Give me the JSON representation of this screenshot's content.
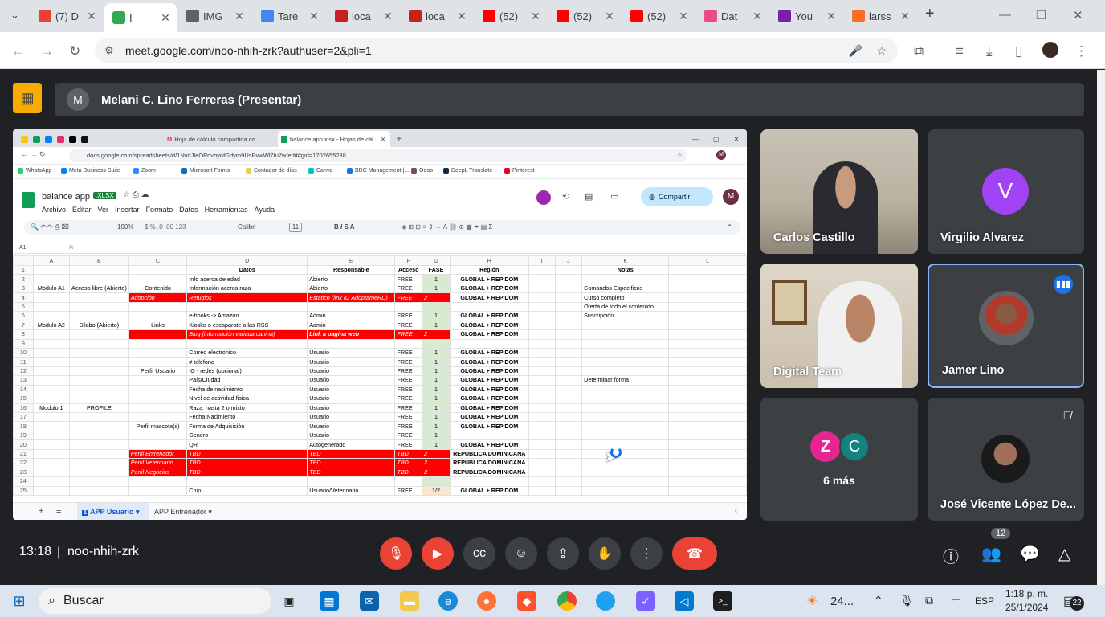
{
  "browser": {
    "tabs": [
      {
        "label": "(7) D",
        "color": "#e94235"
      },
      {
        "label": "I",
        "color": "#34a853",
        "active": true
      },
      {
        "label": "IMG",
        "color": "#5f6368"
      },
      {
        "label": "Tare",
        "color": "#4285f4"
      },
      {
        "label": "loca",
        "color": "#c5221f"
      },
      {
        "label": "loca",
        "color": "#c5221f"
      },
      {
        "label": "(52)",
        "color": "#ff0000"
      },
      {
        "label": "(52)",
        "color": "#ff0000"
      },
      {
        "label": "(52)",
        "color": "#ff0000"
      },
      {
        "label": "Dat",
        "color": "#ea4c89"
      },
      {
        "label": "You",
        "color": "#7b1fa2"
      },
      {
        "label": "larss",
        "color": "#fc6d26"
      }
    ],
    "url": "meet.google.com/noo-nhih-zrk?authuser=2&pli=1"
  },
  "meet": {
    "presenter_initial": "M",
    "presenter_title": "Melani C. Lino Ferreras (Presentar)",
    "time": "13:18",
    "meeting_code": "noo-nhih-zrk",
    "participant_count": "12",
    "participants": [
      {
        "name": "Carlos Castillo"
      },
      {
        "name": "Virgilio Alvarez",
        "initial": "V"
      },
      {
        "name": "Digital Team"
      },
      {
        "name": "Jamer Lino"
      },
      {
        "name": "6 más",
        "initials": [
          "Z",
          "C"
        ]
      },
      {
        "name": "José Vicente López De..."
      }
    ]
  },
  "shared": {
    "tabs": [
      "Hoja de cálculo compartida co",
      "balance app.xlsx - Hojas de cál"
    ],
    "url": "docs.google.com/spreadsheets/d/1NvdJleOPqvbynfGdym9UsPvwWl7tu7w/edit#gid=1702655238",
    "bookmarks": [
      "WhatsApp",
      "Meta Business Suite",
      "Zoom",
      "Microsoft Forms",
      "Contador de días",
      "Canva",
      "BDC Management |...",
      "Odoo",
      "DeepL Translate",
      "Pinterest"
    ],
    "doc_title": "balance app",
    "doc_ext": ".XLSX",
    "menus": [
      "Archivo",
      "Editar",
      "Ver",
      "Insertar",
      "Formato",
      "Datos",
      "Herramientas",
      "Ayuda"
    ],
    "share_label": "Compartir",
    "zoom": "100%",
    "font": "Calibri",
    "font_size": "11",
    "cell_ref": "A1",
    "col_headers": [
      "A",
      "B",
      "C",
      "D",
      "E",
      "F",
      "G",
      "H",
      "I",
      "J",
      "K",
      "L"
    ],
    "header_row": [
      "",
      "",
      "",
      "Datos",
      "Responsable",
      "Acceso",
      "FASE",
      "Región",
      "",
      "",
      "Notas",
      ""
    ],
    "rows": [
      [
        "2",
        "",
        "",
        "",
        "Info acerca de edad",
        "Abierto",
        "FREE",
        "1",
        "GLOBAL + REP DOM",
        "",
        "",
        "",
        ""
      ],
      [
        "3",
        "Modulo A1",
        "Acceso libre (Abierto)",
        "Contenido",
        "Información acerca raza",
        "Abierto",
        "FREE",
        "1",
        "GLOBAL + REP DOM",
        "",
        "",
        "Comandos Especificos",
        ""
      ],
      [
        "4",
        "",
        "",
        "Adopción",
        "Refugios",
        "Estático (link IG AdoptameRD)",
        "FREE",
        "2",
        "GLOBAL + REP DOM",
        "",
        "",
        "Curso completo",
        ""
      ],
      [
        "5",
        "",
        "",
        "",
        "",
        "",
        "",
        "",
        "",
        "",
        "",
        "Oferta de todo el contenido",
        ""
      ],
      [
        "6",
        "",
        "",
        "",
        "e-books -> Amazon",
        "Admin",
        "FREE",
        "1",
        "GLOBAL + REP DOM",
        "",
        "",
        "Suscripción",
        ""
      ],
      [
        "7",
        "Modulo A2",
        "Silabo (Abierto)",
        "Links",
        "Kiosko o escaparate a las RSS",
        "Admin",
        "FREE",
        "1",
        "GLOBAL + REP DOM",
        "",
        "",
        "",
        ""
      ],
      [
        "8",
        "",
        "",
        "",
        "Blog (información variada canina)",
        "Link a pagina web",
        "FREE",
        "2",
        "GLOBAL + REP DOM",
        "",
        "",
        "",
        ""
      ],
      [
        "9",
        "",
        "",
        "",
        "",
        "",
        "",
        "",
        "",
        "",
        "",
        "",
        ""
      ],
      [
        "10",
        "",
        "",
        "",
        "Correo electronico",
        "Usuario",
        "FREE",
        "1",
        "GLOBAL + REP DOM",
        "",
        "",
        "",
        ""
      ],
      [
        "11",
        "",
        "",
        "",
        "# teléfono",
        "Usuario",
        "FREE",
        "1",
        "GLOBAL + REP DOM",
        "",
        "",
        "",
        ""
      ],
      [
        "12",
        "",
        "",
        "Perfil Usuario",
        "IG - redes (opcional)",
        "Usuario",
        "FREE",
        "1",
        "GLOBAL + REP DOM",
        "",
        "",
        "",
        ""
      ],
      [
        "13",
        "",
        "",
        "",
        "País/Ciudad",
        "Usuario",
        "FREE",
        "1",
        "GLOBAL + REP DOM",
        "",
        "",
        "Determinar forma",
        ""
      ],
      [
        "14",
        "",
        "",
        "",
        "Fecha de nacimiento",
        "Usuario",
        "FREE",
        "1",
        "GLOBAL + REP DOM",
        "",
        "",
        "",
        ""
      ],
      [
        "15",
        "",
        "",
        "",
        "Nivel de actividad fisica",
        "Usuario",
        "FREE",
        "1",
        "GLOBAL + REP DOM",
        "",
        "",
        "",
        ""
      ],
      [
        "16",
        "Modulo 1",
        "PROFILE",
        "",
        "Raza: hasta 2 o mixto",
        "Usuario",
        "FREE",
        "1",
        "GLOBAL + REP DOM",
        "",
        "",
        "",
        ""
      ],
      [
        "17",
        "",
        "",
        "",
        "Fecha Nacimiento",
        "Usuario",
        "FREE",
        "1",
        "GLOBAL + REP DOM",
        "",
        "",
        "",
        ""
      ],
      [
        "18",
        "",
        "",
        "Perfil mascota(s)",
        "Forma de Adquisición",
        "Usuario",
        "FREE",
        "1",
        "GLOBAL + REP DOM",
        "",
        "",
        "",
        ""
      ],
      [
        "19",
        "",
        "",
        "",
        "Genero",
        "Usuario",
        "FREE",
        "1",
        "",
        "",
        "",
        "",
        ""
      ],
      [
        "20",
        "",
        "",
        "",
        "QR",
        "Autogenerado",
        "FREE",
        "1",
        "GLOBAL + REP DOM",
        "",
        "",
        "",
        ""
      ],
      [
        "21",
        "",
        "",
        "Perfil Entrenador",
        "TBD",
        "TBD",
        "TBD",
        "2",
        "REPUBLICA DOMINICANA",
        "",
        "",
        "",
        ""
      ],
      [
        "22",
        "",
        "",
        "Perfil Veterinario",
        "TBD",
        "TBD",
        "TBD",
        "2",
        "REPUBLICA DOMINICANA",
        "",
        "",
        "",
        ""
      ],
      [
        "23",
        "",
        "",
        "Perfil Negocios",
        "TBD",
        "TBD",
        "TBD",
        "2",
        "REPUBLICA DOMINICANA",
        "",
        "",
        "",
        ""
      ],
      [
        "24",
        "",
        "",
        "",
        "",
        "",
        "",
        "",
        "",
        "",
        "",
        "",
        ""
      ],
      [
        "25",
        "",
        "",
        "",
        "Chip",
        "Usuario/Veterinario",
        "FREE",
        "1/2",
        "GLOBAL + REP DOM",
        "",
        "",
        "",
        ""
      ]
    ],
    "sheet_tabs": [
      "APP Usuario",
      "APP Entrenador"
    ]
  },
  "taskbar": {
    "search_placeholder": "Buscar",
    "weather": "24...",
    "lang": "ESP",
    "clock_time": "1:18 p. m.",
    "clock_date": "25/1/2024",
    "notif_count": "22"
  }
}
